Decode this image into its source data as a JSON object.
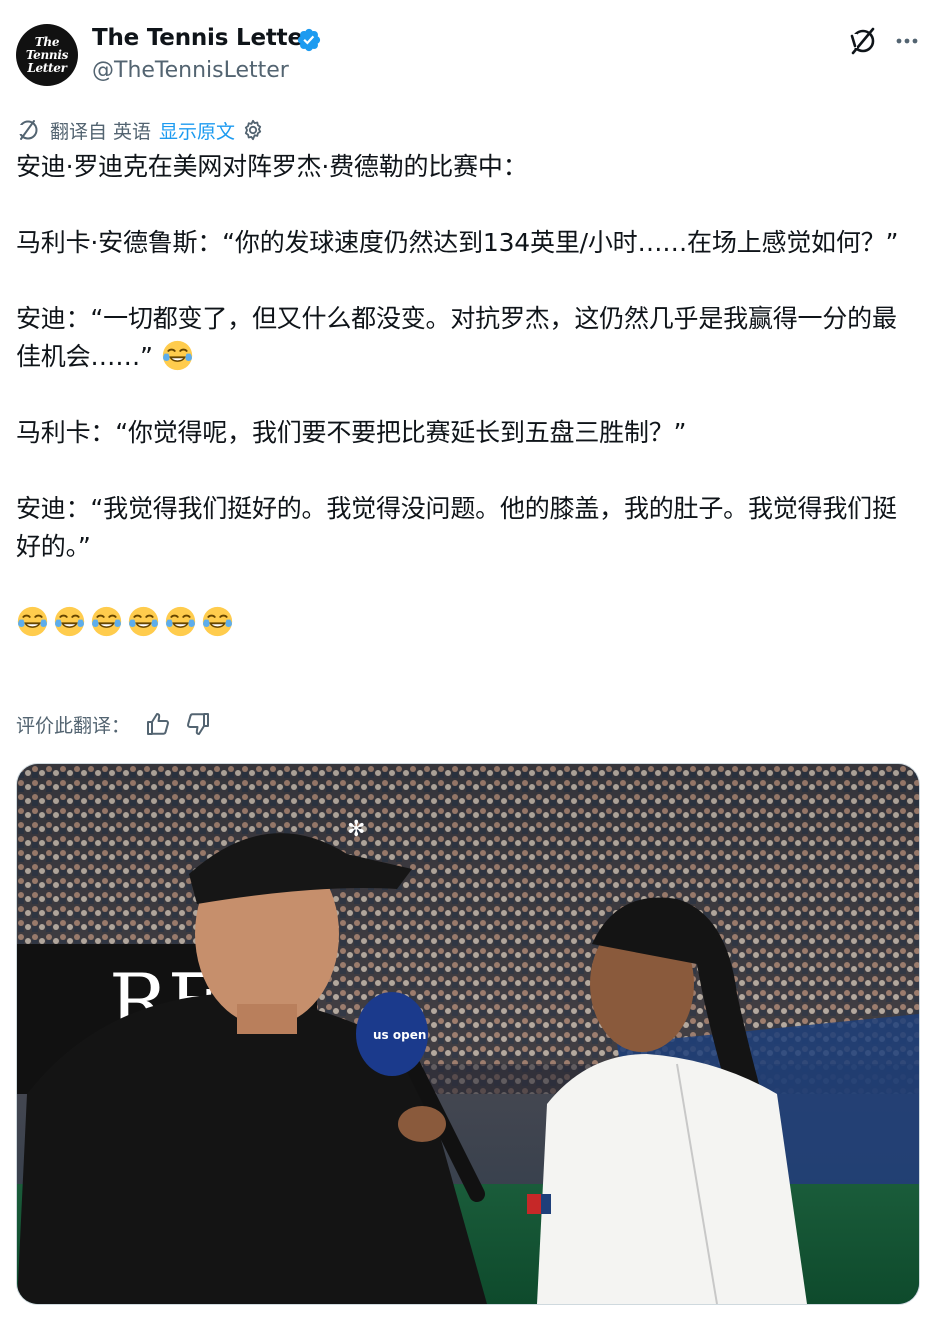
{
  "author": {
    "display_name": "The Tennis Letter",
    "handle": "@TheTennisLetter",
    "avatar_text": [
      "The",
      "Tennis",
      "Letter"
    ],
    "verified": true
  },
  "translation": {
    "from_label": "翻译自",
    "language": "英语",
    "show_original": "显示原文"
  },
  "tweet": {
    "paragraphs": [
      "安迪·罗迪克在美网对阵罗杰·费德勒的比赛中：",
      "马利卡·安德鲁斯：“你的发球速度仍然达到134英里/小时……在场上感觉如何？”",
      "安迪：“一切都变了，但又什么都没变。对抗罗杰，这仍然几乎是我赢得一分的最佳机会……”",
      "马利卡：“你觉得呢，我们要不要把比赛延长到五盘三胜制？”",
      "安迪：“我觉得我们挺好的。我觉得没问题。他的膝盖，我的肚子。我觉得我们挺好的。”"
    ],
    "emoji_row_count": 6
  },
  "rating": {
    "label": "评价此翻译："
  },
  "media": {
    "logo_on_wall": "RF",
    "mic_brand": "us open"
  },
  "colors": {
    "link_blue": "#1d9bf0",
    "verified_blue": "#1d9bf0",
    "secondary_text": "#536471",
    "primary_text": "#0f1419"
  },
  "icons": {
    "grok": "grok-icon",
    "more": "more-horizontal-icon",
    "translate": "translate-icon",
    "settings": "gear-icon",
    "thumb_up": "thumbs-up-icon",
    "thumb_down": "thumbs-down-icon",
    "emoji": "face-with-tears-of-joy-emoji"
  }
}
